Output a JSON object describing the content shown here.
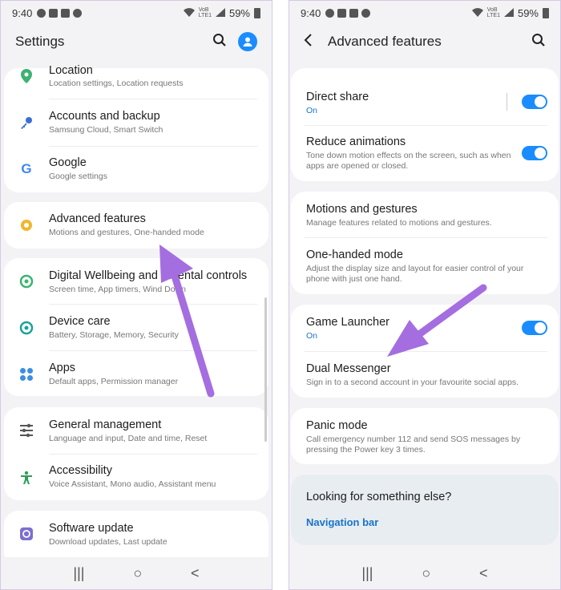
{
  "status": {
    "time": "9:40",
    "battery": "59%",
    "net_a": "VoB",
    "net_b": "LTE1"
  },
  "left": {
    "title": "Settings",
    "items": [
      {
        "title": "Location",
        "subtitle": "Location settings, Location requests"
      },
      {
        "title": "Accounts and backup",
        "subtitle": "Samsung Cloud, Smart Switch"
      },
      {
        "title": "Google",
        "subtitle": "Google settings"
      },
      {
        "title": "Advanced features",
        "subtitle": "Motions and gestures, One-handed mode"
      },
      {
        "title": "Digital Wellbeing and parental controls",
        "subtitle": "Screen time, App timers, Wind Down"
      },
      {
        "title": "Device care",
        "subtitle": "Battery, Storage, Memory, Security"
      },
      {
        "title": "Apps",
        "subtitle": "Default apps, Permission manager"
      },
      {
        "title": "General management",
        "subtitle": "Language and input, Date and time, Reset"
      },
      {
        "title": "Accessibility",
        "subtitle": "Voice Assistant, Mono audio, Assistant menu"
      },
      {
        "title": "Software update",
        "subtitle": "Download updates, Last update"
      }
    ]
  },
  "right": {
    "title": "Advanced features",
    "items": [
      {
        "title": "Direct share",
        "subtitle": "On"
      },
      {
        "title": "Reduce animations",
        "subtitle": "Tone down motion effects on the screen, such as when apps are opened or closed."
      },
      {
        "title": "Motions and gestures",
        "subtitle": "Manage features related to motions and gestures."
      },
      {
        "title": "One-handed mode",
        "subtitle": "Adjust the display size and layout for easier control of your phone with just one hand."
      },
      {
        "title": "Game Launcher",
        "subtitle": "On"
      },
      {
        "title": "Dual Messenger",
        "subtitle": "Sign in to a second account in your favourite social apps."
      },
      {
        "title": "Panic mode",
        "subtitle": "Call emergency number 112 and send SOS messages by pressing the Power key 3 times."
      }
    ],
    "looking": {
      "heading": "Looking for something else?",
      "link": "Navigation bar"
    }
  },
  "nav": {
    "recents": "|||",
    "home": "○",
    "back": "<"
  },
  "colors": {
    "accent": "#1a8cff",
    "arrow": "#a46ee0"
  }
}
